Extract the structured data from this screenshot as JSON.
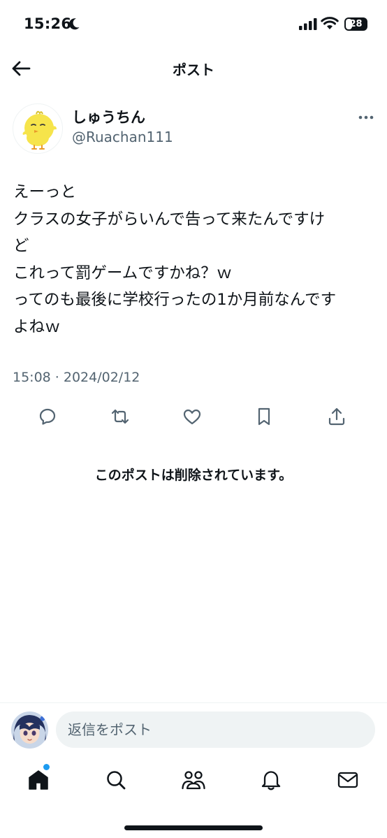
{
  "status_bar": {
    "time": "15:26",
    "battery": "28"
  },
  "header": {
    "title": "ポスト"
  },
  "post": {
    "display_name": "しゅうちん",
    "handle": "@Ruachan111",
    "lines": [
      "えーっと",
      "クラスの女子がらいんで告って来たんですけ",
      "ど",
      "これって罰ゲームですかね？ｗ",
      "ってのも最後に学校行ったの1か月前なんです",
      "よねｗ"
    ],
    "timestamp": "15:08 · 2024/02/12"
  },
  "actions": [
    "reply-icon",
    "repost-icon",
    "like-icon",
    "bookmark-icon",
    "share-icon"
  ],
  "deleted_notice": "このポストは削除されています。",
  "reply": {
    "placeholder": "返信をポスト"
  },
  "tabs": [
    "home-icon",
    "search-icon",
    "communities-icon",
    "notifications-icon",
    "messages-icon"
  ],
  "colors": {
    "text": "#0f1419",
    "secondary": "#536471",
    "accent": "#1d9bf0",
    "input_bg": "#eff3f4"
  }
}
